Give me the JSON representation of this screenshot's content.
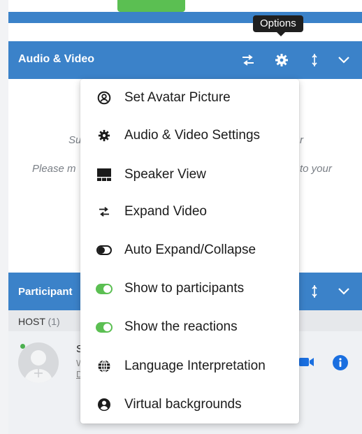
{
  "tooltip": {
    "text": "Options"
  },
  "audio_video": {
    "title": "Audio & Video",
    "peek_left_1": "Su",
    "peek_right_1": "r",
    "peek_left_2": "Please m",
    "peek_right_2": "to your"
  },
  "participants": {
    "title": "Participant",
    "host_label": "HOST",
    "host_count": "(1)",
    "row": {
      "name": "S",
      "sub1": "W",
      "sub2": "D"
    }
  },
  "menu": {
    "items": [
      {
        "label": "Set Avatar Picture",
        "icon": "avatar-circle-icon"
      },
      {
        "label": "Audio & Video Settings",
        "icon": "gear-icon"
      },
      {
        "label": "Speaker View",
        "icon": "speaker-view-icon"
      },
      {
        "label": "Expand Video",
        "icon": "swap-arrows-icon"
      },
      {
        "label": "Auto Expand/Collapse",
        "icon": "toggle-off-icon"
      },
      {
        "label": "Show to participants",
        "icon": "toggle-on-icon"
      },
      {
        "label": "Show the reactions",
        "icon": "toggle-on-icon"
      },
      {
        "label": "Language Interpretation",
        "icon": "globe-icon"
      },
      {
        "label": "Virtual backgrounds",
        "icon": "person-circle-icon"
      }
    ]
  },
  "colors": {
    "header_blue": "#3b82c9",
    "toggle_green": "#5bbf52",
    "icon_blue": "#1a6fe0"
  }
}
